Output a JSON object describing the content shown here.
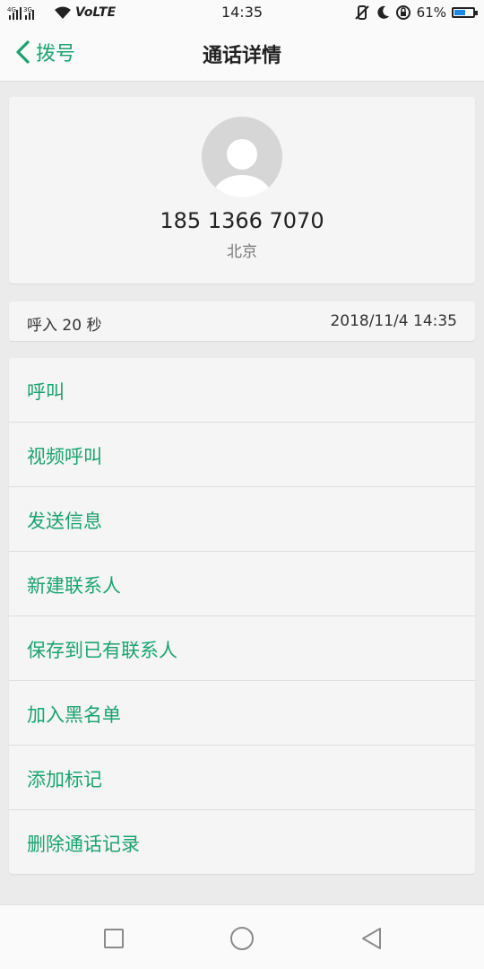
{
  "status_bar": {
    "network": "4G 3G",
    "volte": "VoLTE",
    "time": "14:35",
    "battery": "61%",
    "battery_level": 0.61,
    "battery_color": "#1e88e5"
  },
  "app_bar": {
    "back_label": "拨号",
    "title": "通话详情"
  },
  "contact": {
    "phone_number": "185 1366 7070",
    "location": "北京"
  },
  "call": {
    "type_duration": "呼入  20 秒",
    "datetime": "2018/11/4 14:35"
  },
  "actions": [
    {
      "label": "呼叫",
      "id": "call"
    },
    {
      "label": "视频呼叫",
      "id": "video-call"
    },
    {
      "label": "发送信息",
      "id": "send-message"
    },
    {
      "label": "新建联系人",
      "id": "new-contact"
    },
    {
      "label": "保存到已有联系人",
      "id": "save-existing-contact"
    },
    {
      "label": "加入黑名单",
      "id": "add-blacklist"
    },
    {
      "label": "添加标记",
      "id": "add-tag"
    },
    {
      "label": "删除通话记录",
      "id": "delete-call-log"
    }
  ],
  "icons": {
    "back": "chevron-left-icon",
    "avatar": "person-icon",
    "recent": "square-icon",
    "home": "circle-icon",
    "nav_back": "triangle-back-icon"
  },
  "colors": {
    "accent": "#1aa36f",
    "background": "#ebebeb",
    "card": "#f5f5f5"
  }
}
